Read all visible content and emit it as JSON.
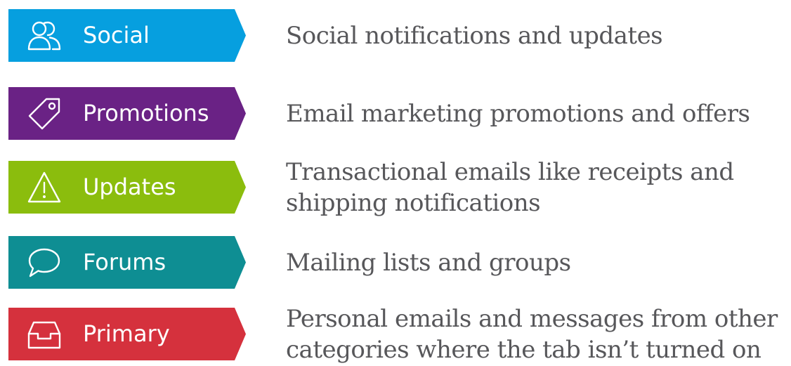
{
  "categories": [
    {
      "label": "Social",
      "icon": "users-icon",
      "color": "#069fdf",
      "description": "Social notifications and updates"
    },
    {
      "label": "Promotions",
      "icon": "tag-icon",
      "color": "#6a2285",
      "description": "Email marketing promotions and offers"
    },
    {
      "label": "Updates",
      "icon": "warning-icon",
      "color": "#8bbd0d",
      "description": "Transactional emails like receipts and shipping notifications"
    },
    {
      "label": "Forums",
      "icon": "speech-bubble-icon",
      "color": "#0e8e93",
      "description": "Mailing lists and groups"
    },
    {
      "label": "Primary",
      "icon": "inbox-tray-icon",
      "color": "#d5313d",
      "description": "Personal emails and messages from other categories where the tab isn’t turned on"
    }
  ]
}
